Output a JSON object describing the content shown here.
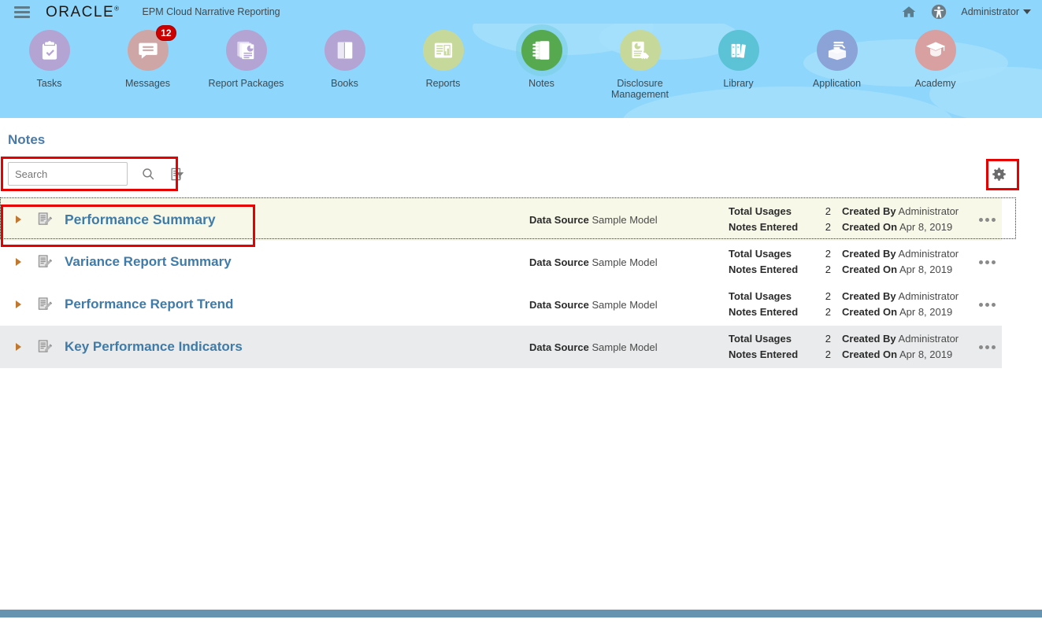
{
  "header": {
    "menu_icon": "hamburger-icon",
    "logo": "ORACLE",
    "app_title": "EPM Cloud Narrative Reporting",
    "home_icon": "home-icon",
    "accessibility_icon": "accessibility-icon",
    "user_label": "Administrator",
    "caret_icon": "chevron-down-icon"
  },
  "nav": {
    "items": [
      {
        "label": "Tasks",
        "icon": "clipboard-check-icon",
        "disc_color": "#b3a4d4",
        "active": false,
        "badge": ""
      },
      {
        "label": "Messages",
        "icon": "chat-bubble-icon",
        "disc_color": "#cfa6a6",
        "active": false,
        "badge": "12"
      },
      {
        "label": "Report Packages",
        "icon": "report-stack-icon",
        "disc_color": "#b3a4d4",
        "active": false,
        "badge": ""
      },
      {
        "label": "Books",
        "icon": "book-icon",
        "disc_color": "#b3a4d4",
        "active": false,
        "badge": ""
      },
      {
        "label": "Reports",
        "icon": "report-chart-icon",
        "disc_color": "#c7d99a",
        "active": false,
        "badge": ""
      },
      {
        "label": "Notes",
        "icon": "notebook-icon",
        "disc_color": "#56a94e",
        "active": true,
        "badge": ""
      },
      {
        "label": "Disclosure Management",
        "icon": "disclosure-tag-icon",
        "disc_color": "#c7d99a",
        "active": false,
        "badge": ""
      },
      {
        "label": "Library",
        "icon": "library-books-icon",
        "disc_color": "#5cc3d6",
        "active": false,
        "badge": ""
      },
      {
        "label": "Application",
        "icon": "application-box-icon",
        "disc_color": "#8ba3d6",
        "active": false,
        "badge": ""
      },
      {
        "label": "Academy",
        "icon": "graduation-cap-icon",
        "disc_color": "#d8a0a0",
        "active": false,
        "badge": ""
      }
    ]
  },
  "page": {
    "title": "Notes",
    "search": {
      "value": "",
      "placeholder": "Search"
    },
    "search_icon": "magnifier-icon",
    "filter_icon": "filter-list-icon",
    "gear_icon": "gear-icon",
    "row_menu_icon": "overflow-menu-icon",
    "expander_icon": "chevron-right-icon",
    "note_icon": "note-edit-icon"
  },
  "labels": {
    "data_source": "Data Source",
    "total_usages": "Total Usages",
    "notes_entered": "Notes Entered",
    "created_by": "Created By",
    "created_on": "Created On"
  },
  "notes": [
    {
      "name": "Performance Summary",
      "data_source": "Sample Model",
      "total_usages": "2",
      "notes_entered": "2",
      "created_by": "Administrator",
      "created_on": "Apr 8, 2019",
      "state": "selected"
    },
    {
      "name": "Variance Report Summary",
      "data_source": "Sample Model",
      "total_usages": "2",
      "notes_entered": "2",
      "created_by": "Administrator",
      "created_on": "Apr 8, 2019",
      "state": "normal"
    },
    {
      "name": "Performance Report Trend",
      "data_source": "Sample Model",
      "total_usages": "2",
      "notes_entered": "2",
      "created_by": "Administrator",
      "created_on": "Apr 8, 2019",
      "state": "normal"
    },
    {
      "name": "Key Performance Indicators",
      "data_source": "Sample Model",
      "total_usages": "2",
      "notes_entered": "2",
      "created_by": "Administrator",
      "created_on": "Apr 8, 2019",
      "state": "alt"
    }
  ],
  "annotations": {
    "highlight_color": "#e60000",
    "boxes": [
      "search-area",
      "gear-button",
      "first-note-row"
    ]
  },
  "colors": {
    "header_blue": "#8ed6fb",
    "link_blue": "#3f7ba9",
    "selected_row": "#f8f8e8",
    "alt_row": "#e9ebec",
    "footer": "#6694b0",
    "badge_red": "#cc0000"
  }
}
